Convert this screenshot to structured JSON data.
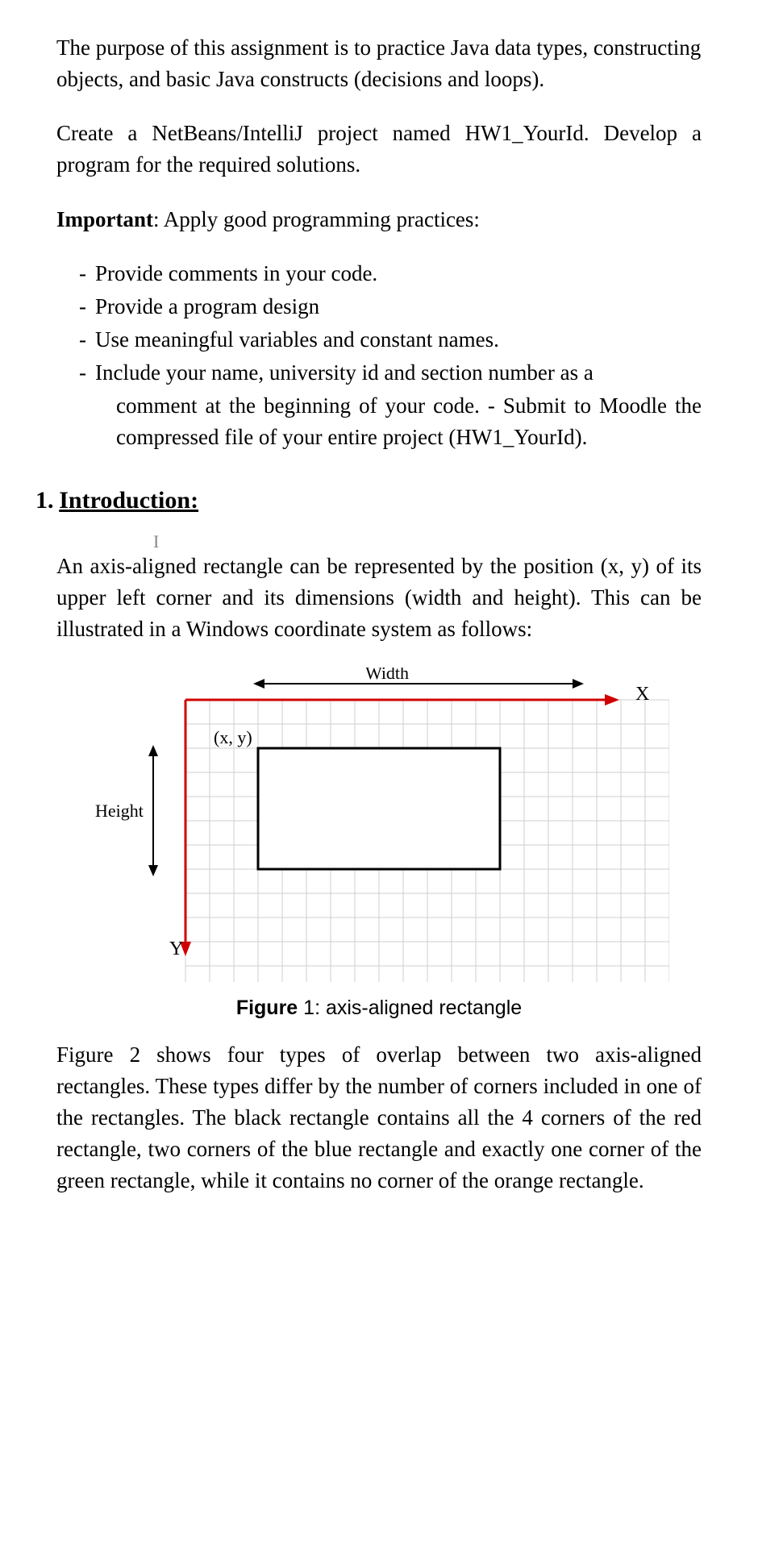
{
  "p1": "The purpose of this assignment is to practice Java data types, constructing objects, and basic Java constructs (decisions and loops).",
  "p2": "Create a NetBeans/IntelliJ project named HW1_YourId. Develop a program for the required solutions.",
  "important_label": "Important",
  "important_rest": ": Apply good programming practices:",
  "bullets": {
    "b1": "Provide comments in your code.",
    "b2": "Provide a program design",
    "b3": "Use meaningful variables and constant names.",
    "b4a": "Include your name, university id and section number as a",
    "b4b": "comment at the beginning of your code. - Submit to Moodle the compressed file of your entire project (HW1_YourId)."
  },
  "heading_num": "1.",
  "heading_title": "Introduction:",
  "intro_para": "An axis-aligned rectangle can be represented by the position (x, y) of its upper left corner and its dimensions (width and height). This can be illustrated in a Windows coordinate system as follows:",
  "fig": {
    "width_label": "Width",
    "x_label": "X",
    "y_label": "Y",
    "xy_label": "(x, y)",
    "height_label": "Height"
  },
  "caption_bold": "Figure",
  "caption_rest": " 1: axis-aligned rectangle",
  "closing_para": "Figure 2 shows four types of overlap between two axis-aligned rectangles. These types differ by the number of corners included in one of the rectangles. The black rectangle contains all the 4 corners of the red rectangle, two corners of the blue rectangle and exactly one corner of the green rectangle, while it contains no corner of the orange rectangle."
}
